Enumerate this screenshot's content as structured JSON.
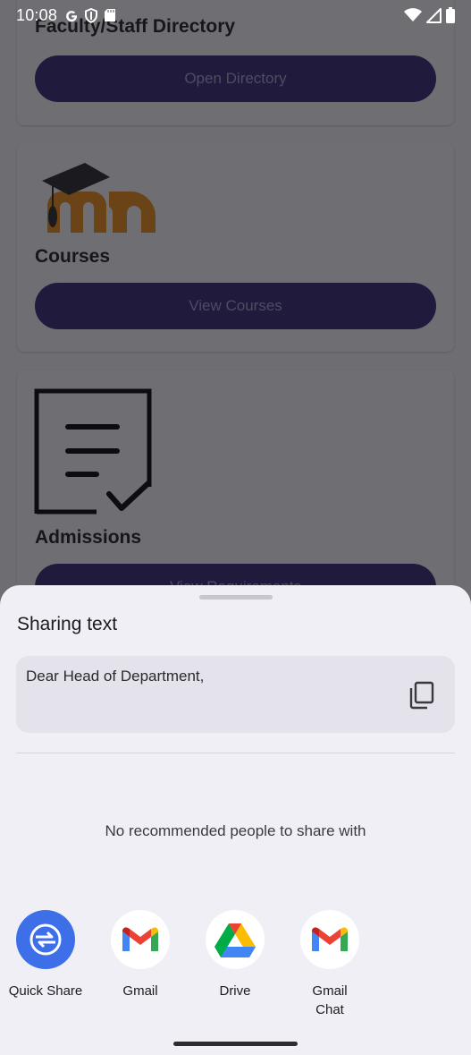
{
  "status_bar": {
    "time": "10:08"
  },
  "background_app": {
    "cards": [
      {
        "title": "Faculty/Staff Directory",
        "button": "Open Directory"
      },
      {
        "title": "Courses",
        "button": "View Courses"
      },
      {
        "title": "Admissions",
        "button": "View Requirements"
      }
    ]
  },
  "share_sheet": {
    "title": "Sharing text",
    "shared_text": "Dear Head of Department,",
    "empty_people_message": "No recommended people to share with",
    "targets": [
      {
        "label": "Quick Share",
        "icon": "quick-share-icon"
      },
      {
        "label": "Gmail",
        "icon": "gmail-icon"
      },
      {
        "label": "Drive",
        "icon": "drive-icon"
      },
      {
        "label": "Gmail\nChat",
        "icon": "gmail-icon"
      }
    ]
  },
  "colors": {
    "accent": "#3d6fe8",
    "sheet_background": "#f1eff6",
    "button_fill": "#201b3d"
  }
}
